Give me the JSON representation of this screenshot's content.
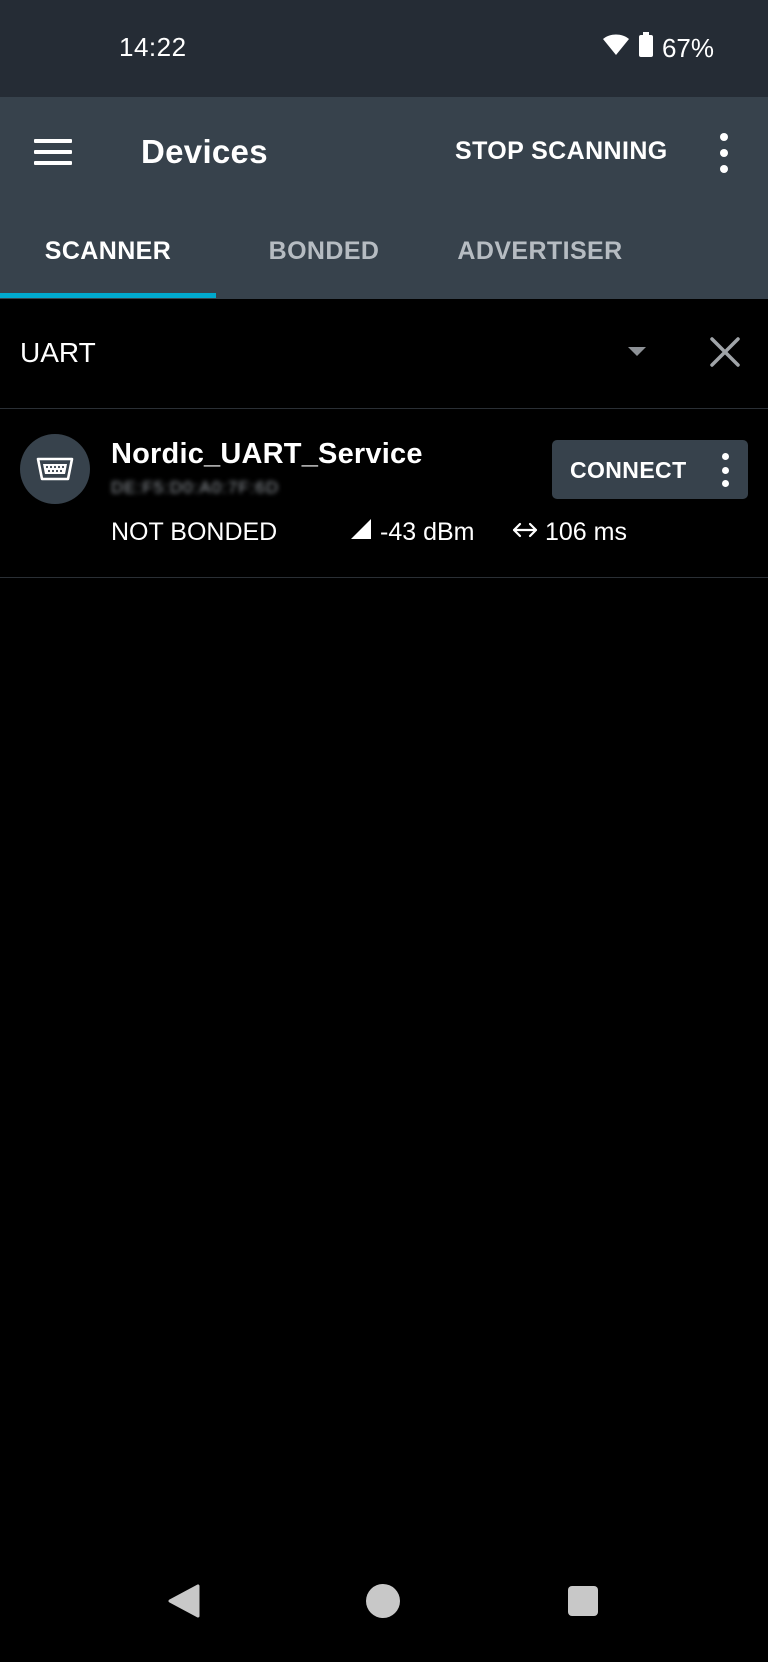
{
  "status_bar": {
    "time": "14:22",
    "battery": "67%",
    "icons": [
      "wifi-icon",
      "battery-icon"
    ]
  },
  "app_bar": {
    "title": "Devices",
    "action_label": "STOP SCANNING",
    "menu_icon": "menu-icon",
    "overflow_icon": "more-vert-icon"
  },
  "tabs": [
    {
      "label": "SCANNER",
      "active": true
    },
    {
      "label": "BONDED",
      "active": false
    },
    {
      "label": "ADVERTISER",
      "active": false
    }
  ],
  "filter": {
    "value": "UART",
    "dropdown_icon": "dropdown-arrow-icon",
    "clear_icon": "close-icon"
  },
  "devices": [
    {
      "name": "Nordic_UART_Service",
      "address": "DE:F5:D0:A0:7F:6D",
      "bond_state": "NOT BONDED",
      "rssi": "-43 dBm",
      "interval": "106 ms",
      "connect_label": "CONNECT",
      "icon": "serial-port-icon"
    }
  ],
  "colors": {
    "status_bar_bg": "#252c35",
    "app_bar_bg": "#37424c",
    "accent": "#00a9ce",
    "background": "#000000"
  },
  "nav_bar": {
    "icons": [
      "back-icon",
      "home-icon",
      "recents-icon"
    ]
  }
}
